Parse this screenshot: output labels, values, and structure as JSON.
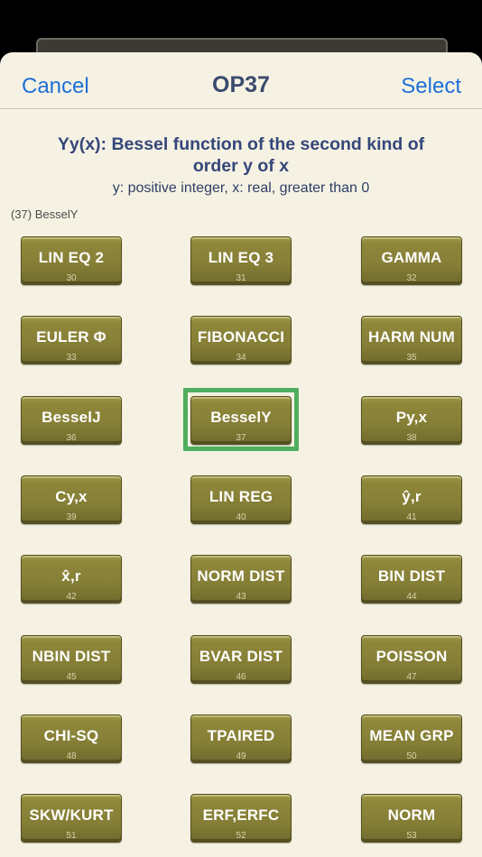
{
  "nav": {
    "cancel": "Cancel",
    "title": "OP37",
    "select": "Select"
  },
  "description": {
    "title": "Yy(x): Bessel function of the second kind of order y of x",
    "subtitle": "y: positive integer, x: real, greater than 0"
  },
  "selected_label": "(37) BesselY",
  "selected_index": 37,
  "colors": {
    "accent": "#1f6fd8",
    "key_gold": "#8e873a",
    "selection": "#4fae5e",
    "sheet_bg": "#f6f2e3"
  },
  "keys": [
    {
      "label": "LIN EQ 2",
      "num": "30"
    },
    {
      "label": "LIN EQ 3",
      "num": "31"
    },
    {
      "label": "GAMMA",
      "num": "32"
    },
    {
      "label": "EULER Φ",
      "num": "33"
    },
    {
      "label": "FIBONACCI",
      "num": "34"
    },
    {
      "label": "HARM NUM",
      "num": "35"
    },
    {
      "label": "BesselJ",
      "num": "36"
    },
    {
      "label": "BesselY",
      "num": "37"
    },
    {
      "label": "Py,x",
      "num": "38"
    },
    {
      "label": "Cy,x",
      "num": "39"
    },
    {
      "label": "LIN REG",
      "num": "40"
    },
    {
      "label": "ŷ,r",
      "num": "41"
    },
    {
      "label": "x̂,r",
      "num": "42"
    },
    {
      "label": "NORM DIST",
      "num": "43"
    },
    {
      "label": "BIN DIST",
      "num": "44"
    },
    {
      "label": "NBIN DIST",
      "num": "45"
    },
    {
      "label": "BVAR DIST",
      "num": "46"
    },
    {
      "label": "POISSON",
      "num": "47"
    },
    {
      "label": "CHI-SQ",
      "num": "48"
    },
    {
      "label": "TPAIRED",
      "num": "49"
    },
    {
      "label": "MEAN GRP",
      "num": "50"
    },
    {
      "label": "SKW/KURT",
      "num": "51"
    },
    {
      "label": "ERF,ERFC",
      "num": "52"
    },
    {
      "label": "NORM",
      "num": "53"
    }
  ]
}
